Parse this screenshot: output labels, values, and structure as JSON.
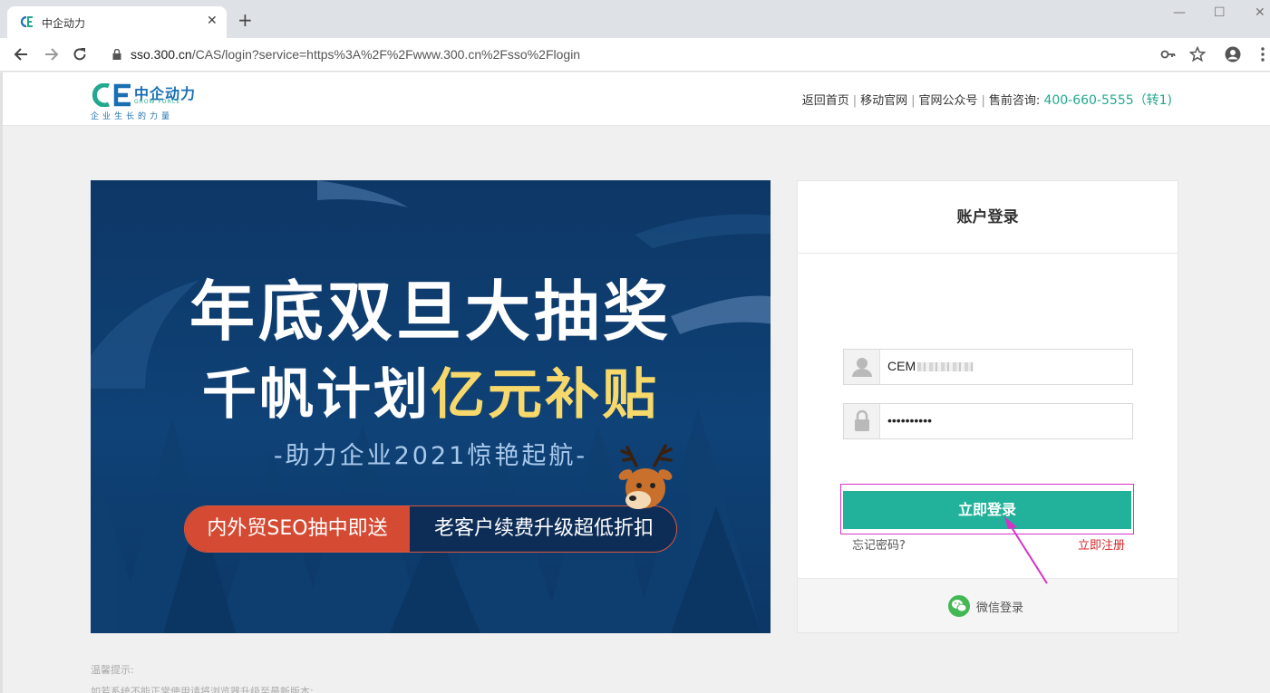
{
  "browser": {
    "tab_title": "中企动力",
    "tab_close": "✕",
    "new_tab": "+",
    "url_host": "sso.300.cn",
    "url_path": "/CAS/login?service=https%3A%2F%2Fwww.300.cn%2Fsso%2Flogin",
    "window_controls": {
      "minimize": "—",
      "maximize": "☐",
      "close": "✕"
    }
  },
  "header": {
    "logo_cn": "中企动力",
    "logo_en": "GROW FORCE",
    "logo_slogan": "企业生长的力量",
    "links": [
      "返回首页",
      "移动官网",
      "官网公众号"
    ],
    "separator": "|",
    "consult_label": "售前咨询:",
    "phone": "400-660-5555（转1)"
  },
  "banner": {
    "title1": "年底双旦大抽奖",
    "title2_plain": "千帆计划",
    "title2_highlight": "亿元补贴",
    "subtitle": "-助力企业2021惊艳起航-",
    "pill_left": "内外贸SEO抽中即送",
    "pill_right": "老客户续费升级超低折扣"
  },
  "login": {
    "title": "账户登录",
    "username_value": "CEM",
    "password_value": "••••••••••",
    "submit_label": "立即登录",
    "forgot_label": "忘记密码?",
    "register_label": "立即注册",
    "wechat_label": "微信登录"
  },
  "footer": {
    "tips_title": "温馨提示:",
    "tips_line": "如若系统不能正常使用请将浏览器升级至最新版本;"
  },
  "colors": {
    "accent": "#22b19a",
    "brand_blue": "#1a6fb3",
    "register_red": "#d2272a",
    "highlight_magenta": "#d633c6",
    "banner_bg": "#0f4277",
    "banner_gold": "#f7d96b"
  },
  "icons": [
    "favicon-icon",
    "back-arrow-icon",
    "forward-arrow-icon",
    "reload-icon",
    "lock-icon",
    "key-icon",
    "star-icon",
    "profile-icon",
    "menu-dots-icon",
    "user-icon",
    "padlock-icon",
    "wechat-icon",
    "pointer-arrow-icon"
  ]
}
